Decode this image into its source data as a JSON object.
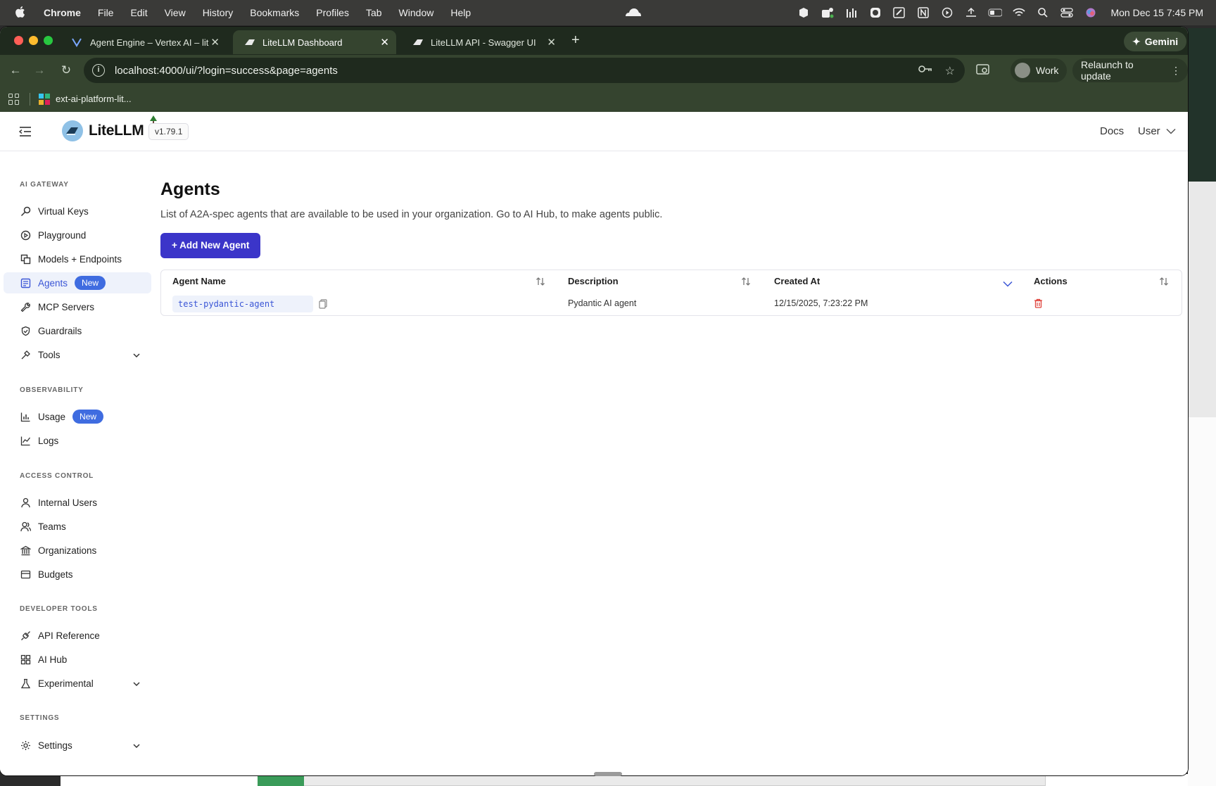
{
  "menubar": {
    "app_name": "Chrome",
    "items": [
      "File",
      "Edit",
      "View",
      "History",
      "Bookmarks",
      "Profiles",
      "Tab",
      "Window",
      "Help"
    ],
    "clock": "Mon Dec 15  7:45 PM"
  },
  "browser": {
    "tabs": [
      {
        "label": "Agent Engine – Vertex AI – lit",
        "icon": "vertex-icon"
      },
      {
        "label": "LiteLLM Dashboard",
        "icon": "litellm-icon"
      },
      {
        "label": "LiteLLM API - Swagger UI",
        "icon": "litellm-icon"
      }
    ],
    "url": "localhost:4000/ui/?login=success&page=agents",
    "profile_label": "Work",
    "relaunch_label": "Relaunch to update",
    "gemini_label": "Gemini",
    "gemini_peek": "Gemini",
    "bookmark": "ext-ai-platform-lit..."
  },
  "header": {
    "logo": "LiteLLM",
    "version": "v1.79.1",
    "docs": "Docs",
    "user": "User"
  },
  "sidebar": {
    "sections": [
      {
        "title": "AI GATEWAY",
        "items": [
          {
            "label": "Virtual Keys",
            "icon": "key-icon"
          },
          {
            "label": "Playground",
            "icon": "play-icon"
          },
          {
            "label": "Models + Endpoints",
            "icon": "models-icon"
          },
          {
            "label": "Agents",
            "icon": "agents-icon",
            "badge": "New"
          },
          {
            "label": "MCP Servers",
            "icon": "wrench-icon"
          },
          {
            "label": "Guardrails",
            "icon": "shield-icon"
          },
          {
            "label": "Tools",
            "icon": "tools-icon"
          }
        ]
      },
      {
        "title": "OBSERVABILITY",
        "items": [
          {
            "label": "Usage",
            "icon": "bar-chart-icon",
            "badge": "New"
          },
          {
            "label": "Logs",
            "icon": "line-chart-icon"
          }
        ]
      },
      {
        "title": "ACCESS CONTROL",
        "items": [
          {
            "label": "Internal Users",
            "icon": "user-icon"
          },
          {
            "label": "Teams",
            "icon": "team-icon"
          },
          {
            "label": "Organizations",
            "icon": "bank-icon"
          },
          {
            "label": "Budgets",
            "icon": "wallet-icon"
          }
        ]
      },
      {
        "title": "DEVELOPER TOOLS",
        "items": [
          {
            "label": "API Reference",
            "icon": "api-icon"
          },
          {
            "label": "AI Hub",
            "icon": "grid-icon"
          },
          {
            "label": "Experimental",
            "icon": "flask-icon"
          }
        ]
      },
      {
        "title": "SETTINGS",
        "items": [
          {
            "label": "Settings",
            "icon": "gear-icon"
          }
        ]
      }
    ]
  },
  "page": {
    "title": "Agents",
    "description": "List of A2A-spec agents that are available to be used in your organization. Go to AI Hub, to make agents public.",
    "add_button": "+ Add New Agent"
  },
  "table": {
    "columns": [
      "Agent Name",
      "Description",
      "Created At",
      "Actions"
    ],
    "rows": [
      {
        "agent_name": "test-pydantic-agent",
        "description": "Pydantic AI agent",
        "created_at": "12/15/2025, 7:23:22 PM"
      }
    ]
  },
  "colors": {
    "accent": "#3b35c9",
    "active_nav": "#3b56d6",
    "badge": "#3f6ce0",
    "danger": "#e0443c",
    "chrome_frame": "#35442f"
  }
}
